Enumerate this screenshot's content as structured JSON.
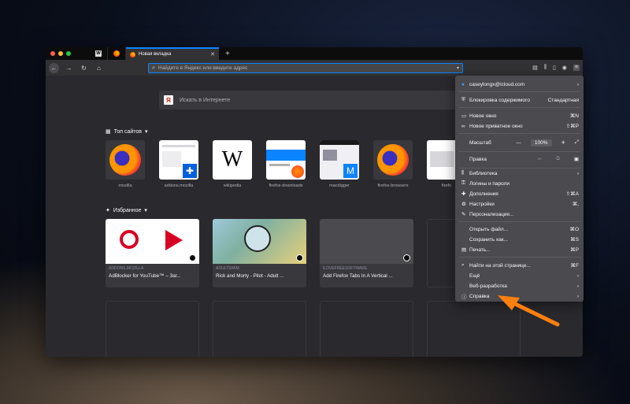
{
  "tabs": {
    "pinned_tab_letter": "W",
    "active_title": "Новая вкладка",
    "new_tab_symbol": "+"
  },
  "toolbar": {
    "url_placeholder": "Найдите в Яндекс или введите адрес"
  },
  "newtab": {
    "search_logo": "Я",
    "search_placeholder": "Искать в Интернете",
    "top_sites_title": "Топ сайтов",
    "highlights_title": "Избранное",
    "top_sites": [
      {
        "label": "mozilla"
      },
      {
        "label": "addons.mozilla"
      },
      {
        "label": "wikipedia"
      },
      {
        "label": "firefox-downloads"
      },
      {
        "label": "macdigger"
      },
      {
        "label": "firefox-browsers"
      },
      {
        "label": "firefo"
      }
    ],
    "highlights": [
      {
        "source": "ADDONS.MOZILLA",
        "title": "AdBlocker for YouTube™ – Заг..."
      },
      {
        "source": "ADULTSWIM",
        "title": "Rick and Morty - Pilot - Adult ..."
      },
      {
        "source": "ILOVEFREESOFTWARE",
        "title": "Add Firefox Tabs In A Vertical ..."
      }
    ]
  },
  "menu": {
    "account": "caseylongx@icloud.com",
    "content_blocking": "Блокировка содержимого",
    "content_blocking_value": "Стандартная",
    "new_window": "Новое окно",
    "new_window_sc": "⌘N",
    "private_window": "Новое приватное окно",
    "private_window_sc": "⇧⌘P",
    "zoom_label": "Масштаб",
    "zoom_minus": "—",
    "zoom_value": "100%",
    "zoom_plus": "+",
    "edit_label": "Правка",
    "library": "Библиотека",
    "logins": "Логины и пароли",
    "addons": "Дополнения",
    "addons_sc": "⇧⌘A",
    "settings": "Настройки",
    "settings_sc": "⌘,",
    "customize": "Персонализация...",
    "open_file": "Открыть файл...",
    "open_file_sc": "⌘O",
    "save_as": "Сохранить как...",
    "save_as_sc": "⌘S",
    "print": "Печать...",
    "print_sc": "⌘P",
    "find": "Найти на этой странице...",
    "find_sc": "⌘F",
    "more": "Ещё",
    "webdev": "Веб-разработка",
    "help": "Справка"
  },
  "colors": {
    "accent": "#0a84ff",
    "annotation_arrow": "#ff7f0e"
  }
}
